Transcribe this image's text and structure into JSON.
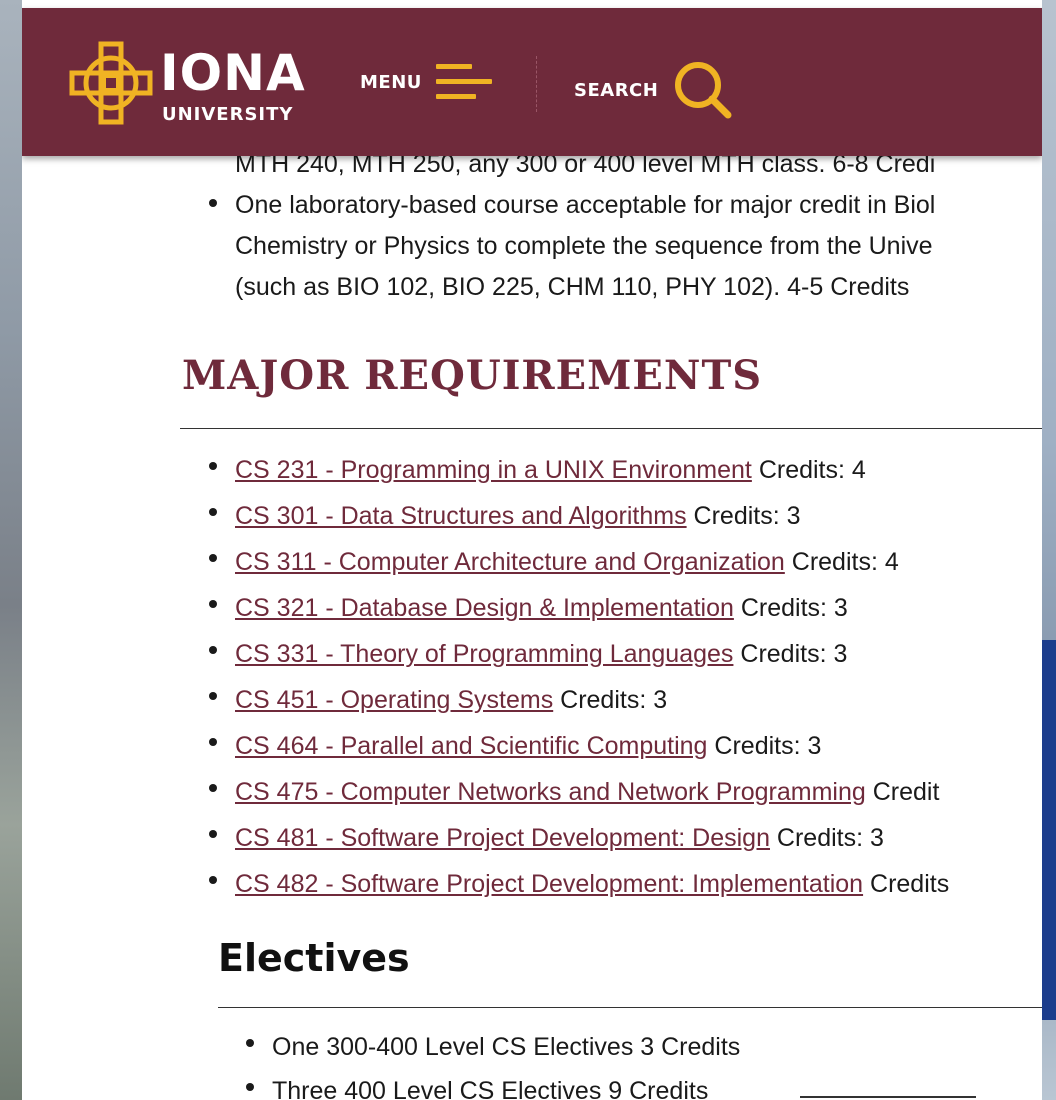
{
  "header": {
    "logo_word": "IONA",
    "logo_sub": "UNIVERSITY",
    "menu_label": "MENU",
    "search_label": "SEARCH",
    "brand_color": "#6f2a3b",
    "accent_color": "#f0b323"
  },
  "gen_requirements": {
    "cut_line": "MTH 240, MTH 250, any 300 or 400 level MTH class. 6-8 Credi",
    "item_lines": [
      "One laboratory-based course acceptable for major credit in Biol",
      "Chemistry or Physics to complete the sequence from the Unive",
      "(such as BIO 102, BIO 225, CHM 110, PHY 102). 4-5 Credits"
    ]
  },
  "major": {
    "title": "MAJOR REQUIREMENTS",
    "courses": [
      {
        "link": "CS 231 - Programming in a UNIX Environment",
        "credits": " Credits: 4"
      },
      {
        "link": "CS 301 - Data Structures and Algorithms",
        "credits": " Credits: 3"
      },
      {
        "link": "CS 311 - Computer Architecture and Organization",
        "credits": " Credits: 4"
      },
      {
        "link": "CS 321 - Database Design & Implementation",
        "credits": " Credits: 3"
      },
      {
        "link": "CS 331 - Theory of Programming Languages",
        "credits": " Credits: 3"
      },
      {
        "link": "CS 451 - Operating Systems",
        "credits": " Credits: 3"
      },
      {
        "link": "CS 464 - Parallel and Scientific Computing",
        "credits": " Credits: 3"
      },
      {
        "link": "CS 475 - Computer Networks and Network Programming",
        "credits": " Credit"
      },
      {
        "link": "CS 481 - Software Project Development: Design",
        "credits": " Credits: 3"
      },
      {
        "link": "CS 482 - Software Project Development: Implementation",
        "credits": " Credits"
      }
    ]
  },
  "electives": {
    "title": "Electives",
    "items": [
      "One 300-400 Level CS Electives  3 Credits",
      "Three 400 Level CS Electives  9 Credits"
    ]
  }
}
